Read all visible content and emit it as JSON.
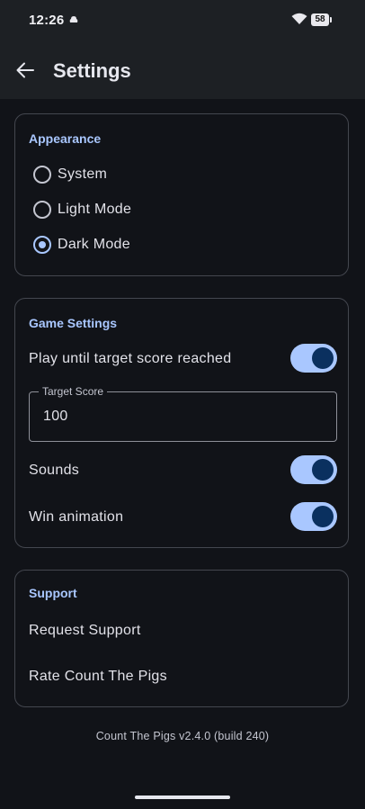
{
  "status_bar": {
    "time": "12:26",
    "battery": "58"
  },
  "header": {
    "title": "Settings"
  },
  "appearance": {
    "title": "Appearance",
    "options": [
      {
        "label": "System",
        "selected": false
      },
      {
        "label": "Light Mode",
        "selected": false
      },
      {
        "label": "Dark Mode",
        "selected": true
      }
    ]
  },
  "game_settings": {
    "title": "Game Settings",
    "play_until_target": {
      "label": "Play until target score reached",
      "enabled": true
    },
    "target_score": {
      "label": "Target Score",
      "value": "100"
    },
    "sounds": {
      "label": "Sounds",
      "enabled": true
    },
    "win_animation": {
      "label": "Win animation",
      "enabled": true
    }
  },
  "support": {
    "title": "Support",
    "request_support": "Request Support",
    "rate_app": "Rate Count The Pigs"
  },
  "footer": {
    "version": "Count The Pigs v2.4.0 (build 240)"
  },
  "colors": {
    "accent": "#a9c7ff",
    "background": "#111318",
    "toolbar": "#1d2024"
  }
}
